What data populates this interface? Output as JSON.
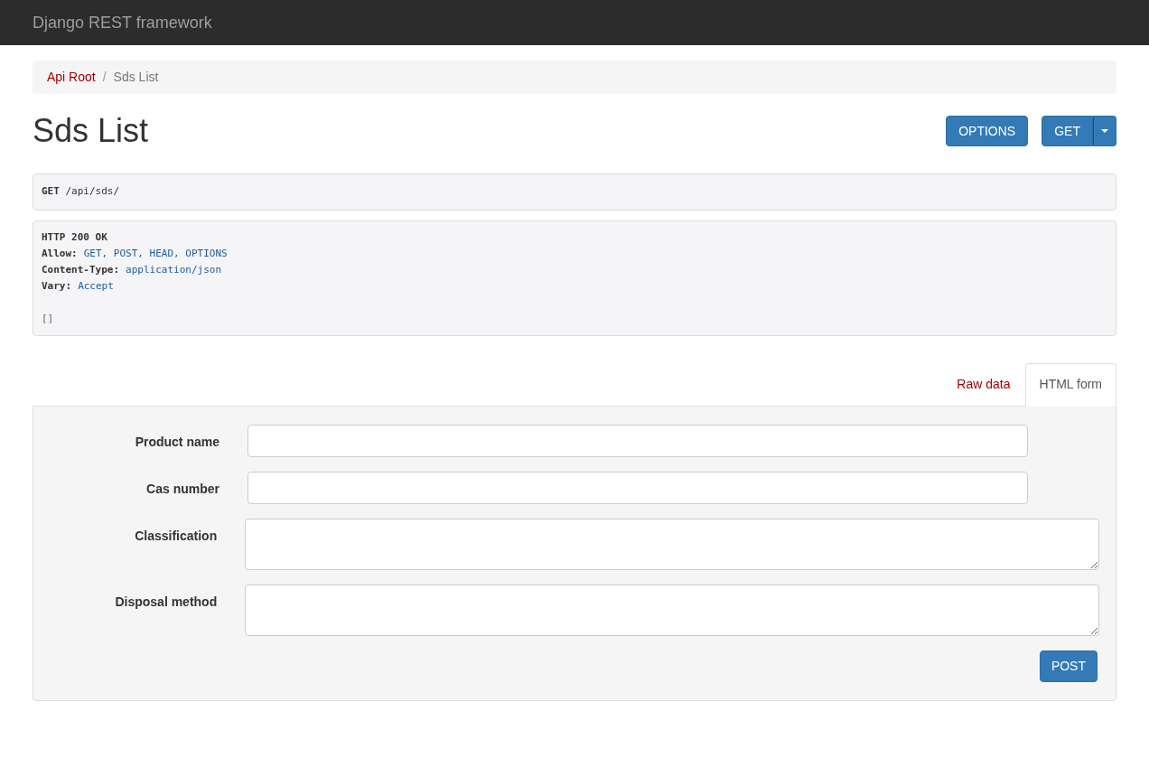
{
  "navbar": {
    "brand": "Django REST framework"
  },
  "breadcrumb_separator": "/",
  "breadcrumb": [
    {
      "label": "Api Root",
      "selected": false
    },
    {
      "label": "Sds List",
      "selected": true
    }
  ],
  "title": "Sds List",
  "actions": {
    "options": "OPTIONS",
    "get": "GET"
  },
  "request": {
    "method": "GET",
    "path": "/api/sds/"
  },
  "response": {
    "status": "HTTP 200 OK",
    "headers": [
      {
        "name": "Allow:",
        "value": "GET, POST, HEAD, OPTIONS"
      },
      {
        "name": "Content-Type:",
        "value": "application/json"
      },
      {
        "name": "Vary:",
        "value": "Accept"
      }
    ],
    "body": "[]"
  },
  "tabs": [
    {
      "label": "Raw data",
      "selected": false
    },
    {
      "label": "HTML form",
      "selected": true
    }
  ],
  "form": {
    "fields": [
      {
        "label": "Product name",
        "kind": "input"
      },
      {
        "label": "Cas number",
        "kind": "input"
      },
      {
        "label": "Classification",
        "kind": "textarea"
      },
      {
        "label": "Disposal method",
        "kind": "textarea"
      }
    ],
    "submit": "POST"
  }
}
